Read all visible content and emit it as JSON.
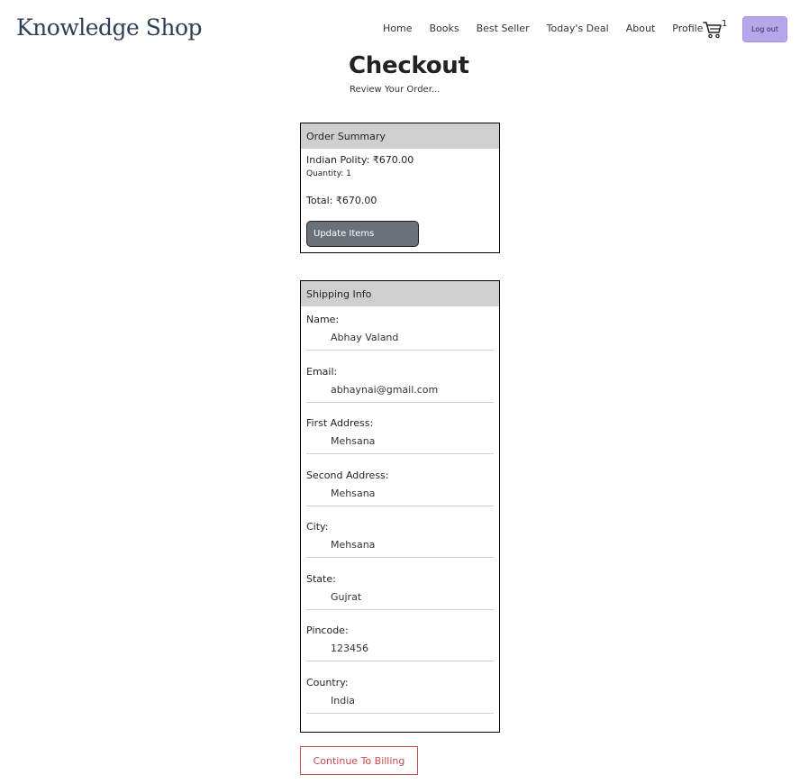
{
  "header": {
    "brand": "Knowledge Shop",
    "nav": [
      "Home",
      "Books",
      "Best Seller",
      "Today's Deal",
      "About",
      "Profile"
    ],
    "cart_count": "1",
    "logout_label": "Log out"
  },
  "page": {
    "title": "Checkout",
    "subtitle": "Review Your Order..."
  },
  "order_summary": {
    "heading": "Order Summary",
    "item": "Indian Polity: ₹670.00",
    "quantity": "Quantity: 1",
    "total": "Total: ₹670.00",
    "update_label": "Update Items"
  },
  "shipping": {
    "heading": "Shipping Info",
    "fields": [
      {
        "label": "Name:",
        "value": "Abhay Valand"
      },
      {
        "label": "Email:",
        "value": "abhaynai@gmail.com"
      },
      {
        "label": "First Address:",
        "value": "Mehsana"
      },
      {
        "label": "Second Address:",
        "value": "Mehsana"
      },
      {
        "label": "City:",
        "value": "Mehsana"
      },
      {
        "label": "State:",
        "value": "Gujrat"
      },
      {
        "label": "Pincode:",
        "value": "123456"
      },
      {
        "label": "Country:",
        "value": "India"
      }
    ]
  },
  "continue_label": "Continue To Billing",
  "colors": {
    "brand": "#2e4057",
    "logout_bg": "#b4a7ea",
    "header_bg": "#cfcfcf",
    "update_bg": "#6b7179",
    "continue_border": "#c94b4b"
  },
  "icons": {
    "cart": "cart-icon"
  }
}
